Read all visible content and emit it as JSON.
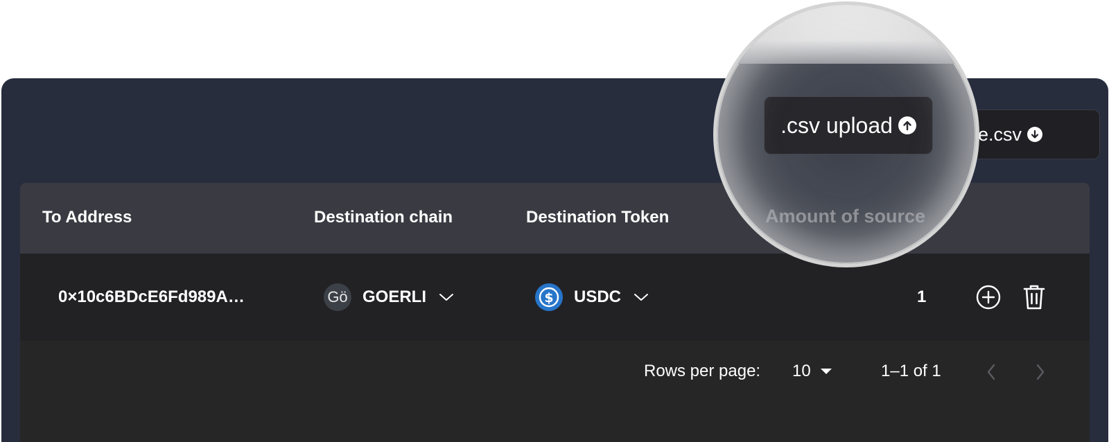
{
  "toolbar": {
    "upload_label": ".csv upload",
    "download_label": "e.csv"
  },
  "table": {
    "headers": [
      "To Address",
      "Destination chain",
      "Destination Token",
      "Amount of source"
    ],
    "rows": [
      {
        "to_address": "0×10c6BDcE6Fd989A…",
        "chain_avatar": "Gö",
        "chain": "GOERLI",
        "token": "USDC",
        "amount": "1"
      }
    ]
  },
  "pagination": {
    "rows_per_page_label": "Rows per page:",
    "rows_per_page_value": "10",
    "range_text": "1–1 of 1"
  },
  "icons": {
    "upload": "arrow-up-circle-icon",
    "download": "arrow-down-circle-icon",
    "chevron": "chevron-down-icon",
    "usdc": "usdc-icon",
    "add": "plus-circle-icon",
    "delete": "trash-icon",
    "prev": "chevron-left-icon",
    "next": "chevron-right-icon"
  },
  "colors": {
    "panel": "#272d3d",
    "header_row": "#3a3b42",
    "row": "#222225",
    "usdc": "#2775ca"
  }
}
